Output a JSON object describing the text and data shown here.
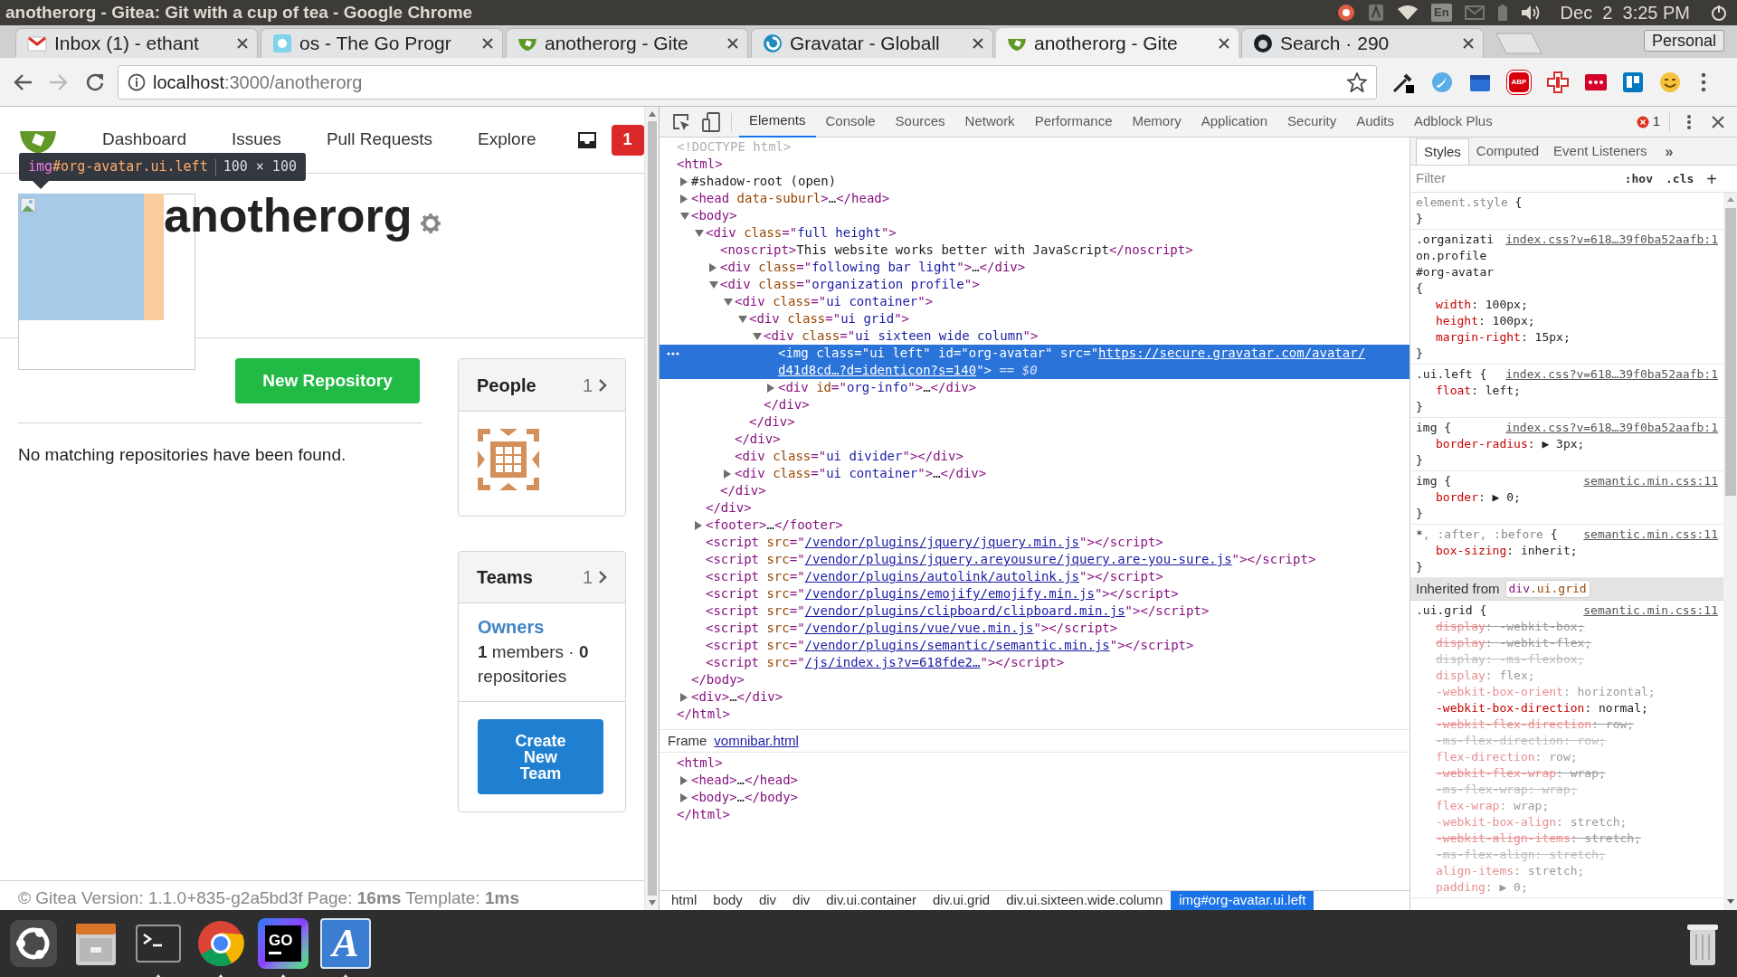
{
  "system_bar": {
    "window_title": "anotherorg - Gitea: Git with a cup of tea - Google Chrome",
    "keyboard_layout": "En",
    "clock": "Dec  2  3:25 PM"
  },
  "browser": {
    "tabs": [
      {
        "title": "Inbox (1) - ethant",
        "kind": "mail",
        "selected": false
      },
      {
        "title": "os - The Go Progr",
        "kind": "gopher",
        "selected": false
      },
      {
        "title": "anotherorg - Gite",
        "kind": "gitea",
        "selected": false
      },
      {
        "title": "Gravatar - Globall",
        "kind": "gravatar",
        "selected": false
      },
      {
        "title": "anotherorg - Gite",
        "kind": "gitea",
        "selected": true
      },
      {
        "title": "Search · 290",
        "kind": "github",
        "selected": false
      }
    ],
    "profile": "Personal",
    "address": {
      "host": "localhost",
      "path": ":3000/anotherorg"
    },
    "extensions": [
      {
        "kind": "eyedropper"
      },
      {
        "kind": "bird"
      },
      {
        "kind": "box"
      },
      {
        "kind": "adblock",
        "label": "ABP"
      },
      {
        "kind": "cross"
      },
      {
        "kind": "dots"
      },
      {
        "kind": "board"
      },
      {
        "kind": "emoji"
      }
    ]
  },
  "page": {
    "nav": [
      "Dashboard",
      "Issues",
      "Pull Requests",
      "Explore"
    ],
    "notifications": "1",
    "inspect_tooltip": {
      "tag": "img",
      "selector": "#org-avatar.ui.left",
      "size": "100 × 100"
    },
    "org_name": "anotherorg",
    "new_repository": "New Repository",
    "empty_message": "No matching repositories have been found.",
    "people": {
      "title": "People",
      "count": "1"
    },
    "teams": {
      "title": "Teams",
      "count": "1",
      "items": [
        {
          "name": "Owners",
          "summary": "**1** members · **0** repositories"
        }
      ],
      "create_button": "Create New Team"
    },
    "footer": "© Gitea Version: 1.1.0+835-g2a5bd3f Page: **16ms** Template: **1ms**"
  },
  "devtools": {
    "tabs": [
      {
        "label": "Elements",
        "selected": true
      },
      {
        "label": "Console",
        "selected": false
      },
      {
        "label": "Sources",
        "selected": false
      },
      {
        "label": "Network",
        "selected": false
      },
      {
        "label": "Performance",
        "selected": false
      },
      {
        "label": "Memory",
        "selected": false
      },
      {
        "label": "Application",
        "selected": false
      },
      {
        "label": "Security",
        "selected": false
      },
      {
        "label": "Audits",
        "selected": false
      },
      {
        "label": "Adblock Plus",
        "selected": false
      }
    ],
    "error_count": "1",
    "dom": [
      {
        "selected": false,
        "open": [
          {
            "kind": "muted",
            "text": "<!DOCTYPE html>"
          }
        ]
      },
      {
        "selected": false,
        "open": [
          {
            "kind": "tag",
            "text": "<html>"
          }
        ],
        "close": [
          {
            "kind": "tag",
            "text": "</html>"
          }
        ],
        "children": [
          {
            "selected": false,
            "expanded": false,
            "open": [
              {
                "kind": "text",
                "text": "#shadow-root (open)"
              }
            ]
          },
          {
            "selected": false,
            "expanded": false,
            "open": [
              {
                "kind": "tag",
                "text": "<head"
              },
              {
                "kind": "attr",
                "text": " data-suburl"
              },
              {
                "kind": "tag",
                "text": ">"
              },
              {
                "kind": "text",
                "text": "…"
              },
              {
                "kind": "tag",
                "text": "</head>"
              }
            ]
          },
          {
            "selected": false,
            "expanded": true,
            "open": [
              {
                "kind": "tag",
                "text": "<body>"
              }
            ],
            "close": [
              {
                "kind": "tag",
                "text": "</body>"
              }
            ],
            "children": [
              {
                "selected": false,
                "expanded": true,
                "open": [
                  {
                    "kind": "tag",
                    "text": "<div"
                  },
                  {
                    "kind": "attr",
                    "text": " class"
                  },
                  {
                    "kind": "tag",
                    "text": "=\""
                  },
                  {
                    "kind": "value",
                    "text": "full height"
                  },
                  {
                    "kind": "tag",
                    "text": "\">"
                  }
                ],
                "close": [
                  {
                    "kind": "tag",
                    "text": "</div>"
                  }
                ],
                "children": [
                  {
                    "selected": false,
                    "open": [
                      {
                        "kind": "tag",
                        "text": "<noscript>"
                      },
                      {
                        "kind": "text",
                        "text": "This website works better with JavaScript"
                      },
                      {
                        "kind": "tag",
                        "text": "</noscript>"
                      }
                    ]
                  },
                  {
                    "selected": false,
                    "expanded": false,
                    "open": [
                      {
                        "kind": "tag",
                        "text": "<div"
                      },
                      {
                        "kind": "attr",
                        "text": " class"
                      },
                      {
                        "kind": "tag",
                        "text": "=\""
                      },
                      {
                        "kind": "value",
                        "text": "following bar light"
                      },
                      {
                        "kind": "tag",
                        "text": "\">"
                      },
                      {
                        "kind": "text",
                        "text": "…"
                      },
                      {
                        "kind": "tag",
                        "text": "</div>"
                      }
                    ]
                  },
                  {
                    "selected": false,
                    "expanded": true,
                    "open": [
                      {
                        "kind": "tag",
                        "text": "<div"
                      },
                      {
                        "kind": "attr",
                        "text": " class"
                      },
                      {
                        "kind": "tag",
                        "text": "=\""
                      },
                      {
                        "kind": "value",
                        "text": "organization profile"
                      },
                      {
                        "kind": "tag",
                        "text": "\">"
                      }
                    ],
                    "close": [
                      {
                        "kind": "tag",
                        "text": "</div>"
                      }
                    ],
                    "children": [
                      {
                        "selected": false,
                        "expanded": true,
                        "open": [
                          {
                            "kind": "tag",
                            "text": "<div"
                          },
                          {
                            "kind": "attr",
                            "text": " class"
                          },
                          {
                            "kind": "tag",
                            "text": "=\""
                          },
                          {
                            "kind": "value",
                            "text": "ui container"
                          },
                          {
                            "kind": "tag",
                            "text": "\">"
                          }
                        ],
                        "close": [
                          {
                            "kind": "tag",
                            "text": "</div>"
                          }
                        ],
                        "children": [
                          {
                            "selected": false,
                            "expanded": true,
                            "open": [
                              {
                                "kind": "tag",
                                "text": "<div"
                              },
                              {
                                "kind": "attr",
                                "text": " class"
                              },
                              {
                                "kind": "tag",
                                "text": "=\""
                              },
                              {
                                "kind": "value",
                                "text": "ui grid"
                              },
                              {
                                "kind": "tag",
                                "text": "\">"
                              }
                            ],
                            "close": [
                              {
                                "kind": "tag",
                                "text": "</div>"
                              }
                            ],
                            "children": [
                              {
                                "selected": false,
                                "expanded": true,
                                "open": [
                                  {
                                    "kind": "tag",
                                    "text": "<div"
                                  },
                                  {
                                    "kind": "attr",
                                    "text": " class"
                                  },
                                  {
                                    "kind": "tag",
                                    "text": "=\""
                                  },
                                  {
                                    "kind": "value",
                                    "text": "ui sixteen wide column"
                                  },
                                  {
                                    "kind": "tag",
                                    "text": "\">"
                                  }
                                ],
                                "close": [
                                  {
                                    "kind": "tag",
                                    "text": "</div>"
                                  }
                                ],
                                "children": [
                                  {
                                    "selected": true,
                                    "open": [
                                      {
                                        "kind": "tag",
                                        "text": "<img"
                                      },
                                      {
                                        "kind": "attr",
                                        "text": " class"
                                      },
                                      {
                                        "kind": "tag",
                                        "text": "=\""
                                      },
                                      {
                                        "kind": "value",
                                        "text": "ui left"
                                      },
                                      {
                                        "kind": "tag",
                                        "text": "\""
                                      },
                                      {
                                        "kind": "attr",
                                        "text": " id"
                                      },
                                      {
                                        "kind": "tag",
                                        "text": "=\""
                                      },
                                      {
                                        "kind": "value",
                                        "text": "org-avatar"
                                      },
                                      {
                                        "kind": "tag",
                                        "text": "\""
                                      },
                                      {
                                        "kind": "attr",
                                        "text": " src"
                                      },
                                      {
                                        "kind": "tag",
                                        "text": "=\""
                                      },
                                      {
                                        "kind": "link",
                                        "text": "https://secure.gravatar.com/avatar/"
                                      },
                                      {
                                        "kind": "link",
                                        "text": "d41d8cd…?d=identicon?s=140"
                                      },
                                      {
                                        "kind": "tag",
                                        "text": "\">"
                                      },
                                      {
                                        "kind": "hint",
                                        "text": " == $0"
                                      }
                                    ]
                                  },
                                  {
                                    "selected": false,
                                    "expanded": false,
                                    "open": [
                                      {
                                        "kind": "tag",
                                        "text": "<div"
                                      },
                                      {
                                        "kind": "attr",
                                        "text": " id"
                                      },
                                      {
                                        "kind": "tag",
                                        "text": "=\""
                                      },
                                      {
                                        "kind": "value",
                                        "text": "org-info"
                                      },
                                      {
                                        "kind": "tag",
                                        "text": "\">"
                                      },
                                      {
                                        "kind": "text",
                                        "text": "…"
                                      },
                                      {
                                        "kind": "tag",
                                        "text": "</div>"
                                      }
                                    ]
                                  }
                                ]
                              }
                            ]
                          }
                        ]
                      },
                      {
                        "selected": false,
                        "open": [
                          {
                            "kind": "tag",
                            "text": "<div"
                          },
                          {
                            "kind": "attr",
                            "text": " class"
                          },
                          {
                            "kind": "tag",
                            "text": "=\""
                          },
                          {
                            "kind": "value",
                            "text": "ui divider"
                          },
                          {
                            "kind": "tag",
                            "text": "\"></div>"
                          }
                        ]
                      },
                      {
                        "selected": false,
                        "expanded": false,
                        "open": [
                          {
                            "kind": "tag",
                            "text": "<div"
                          },
                          {
                            "kind": "attr",
                            "text": " class"
                          },
                          {
                            "kind": "tag",
                            "text": "=\""
                          },
                          {
                            "kind": "value",
                            "text": "ui container"
                          },
                          {
                            "kind": "tag",
                            "text": "\">"
                          },
                          {
                            "kind": "text",
                            "text": "…"
                          },
                          {
                            "kind": "tag",
                            "text": "</div>"
                          }
                        ]
                      }
                    ]
                  }
                ]
              },
              {
                "selected": false,
                "expanded": false,
                "open": [
                  {
                    "kind": "tag",
                    "text": "<footer>"
                  },
                  {
                    "kind": "text",
                    "text": "…"
                  },
                  {
                    "kind": "tag",
                    "text": "</footer>"
                  }
                ]
              },
              {
                "selected": false,
                "open": [
                  {
                    "kind": "tag",
                    "text": "<script"
                  },
                  {
                    "kind": "attr",
                    "text": " src"
                  },
                  {
                    "kind": "tag",
                    "text": "=\""
                  },
                  {
                    "kind": "link",
                    "text": "/vendor/plugins/jquery/jquery.min.js"
                  },
                  {
                    "kind": "tag",
                    "text": "\"></script>"
                  }
                ]
              },
              {
                "selected": false,
                "open": [
                  {
                    "kind": "tag",
                    "text": "<script"
                  },
                  {
                    "kind": "attr",
                    "text": " src"
                  },
                  {
                    "kind": "tag",
                    "text": "=\""
                  },
                  {
                    "kind": "link",
                    "text": "/vendor/plugins/jquery.areyousure/jquery.are-you-sure.js"
                  },
                  {
                    "kind": "tag",
                    "text": "\"></script>"
                  }
                ]
              },
              {
                "selected": false,
                "open": [
                  {
                    "kind": "tag",
                    "text": "<script"
                  },
                  {
                    "kind": "attr",
                    "text": " src"
                  },
                  {
                    "kind": "tag",
                    "text": "=\""
                  },
                  {
                    "kind": "link",
                    "text": "/vendor/plugins/autolink/autolink.js"
                  },
                  {
                    "kind": "tag",
                    "text": "\"></script>"
                  }
                ]
              },
              {
                "selected": false,
                "open": [
                  {
                    "kind": "tag",
                    "text": "<script"
                  },
                  {
                    "kind": "attr",
                    "text": " src"
                  },
                  {
                    "kind": "tag",
                    "text": "=\""
                  },
                  {
                    "kind": "link",
                    "text": "/vendor/plugins/emojify/emojify.min.js"
                  },
                  {
                    "kind": "tag",
                    "text": "\"></script>"
                  }
                ]
              },
              {
                "selected": false,
                "open": [
                  {
                    "kind": "tag",
                    "text": "<script"
                  },
                  {
                    "kind": "attr",
                    "text": " src"
                  },
                  {
                    "kind": "tag",
                    "text": "=\""
                  },
                  {
                    "kind": "link",
                    "text": "/vendor/plugins/clipboard/clipboard.min.js"
                  },
                  {
                    "kind": "tag",
                    "text": "\"></script>"
                  }
                ]
              },
              {
                "selected": false,
                "open": [
                  {
                    "kind": "tag",
                    "text": "<script"
                  },
                  {
                    "kind": "attr",
                    "text": " src"
                  },
                  {
                    "kind": "tag",
                    "text": "=\""
                  },
                  {
                    "kind": "link",
                    "text": "/vendor/plugins/vue/vue.min.js"
                  },
                  {
                    "kind": "tag",
                    "text": "\"></script>"
                  }
                ]
              },
              {
                "selected": false,
                "open": [
                  {
                    "kind": "tag",
                    "text": "<script"
                  },
                  {
                    "kind": "attr",
                    "text": " src"
                  },
                  {
                    "kind": "tag",
                    "text": "=\""
                  },
                  {
                    "kind": "link",
                    "text": "/vendor/plugins/semantic/semantic.min.js"
                  },
                  {
                    "kind": "tag",
                    "text": "\"></script>"
                  }
                ]
              },
              {
                "selected": false,
                "open": [
                  {
                    "kind": "tag",
                    "text": "<script"
                  },
                  {
                    "kind": "attr",
                    "text": " src"
                  },
                  {
                    "kind": "tag",
                    "text": "=\""
                  },
                  {
                    "kind": "link",
                    "text": "/js/index.js?v=618fde2…"
                  },
                  {
                    "kind": "tag",
                    "text": "\"></script>"
                  }
                ]
              }
            ]
          },
          {
            "selected": false,
            "expanded": false,
            "open": [
              {
                "kind": "tag",
                "text": "<div>"
              },
              {
                "kind": "text",
                "text": "…"
              },
              {
                "kind": "tag",
                "text": "</div>"
              }
            ]
          }
        ]
      }
    ],
    "frame": {
      "label": "Frame",
      "link": "vomnibar.html",
      "dom": [
        {
          "selected": false,
          "open": [
            {
              "kind": "tag",
              "text": "<html>"
            }
          ],
          "close": [
            {
              "kind": "tag",
              "text": "</html>"
            }
          ],
          "children": [
            {
              "selected": false,
              "expanded": false,
              "open": [
                {
                  "kind": "tag",
                  "text": "<head>"
                },
                {
                  "kind": "text",
                  "text": "…"
                },
                {
                  "kind": "tag",
                  "text": "</head>"
                }
              ]
            },
            {
              "selected": false,
              "expanded": false,
              "open": [
                {
                  "kind": "tag",
                  "text": "<body>"
                },
                {
                  "kind": "text",
                  "text": "…"
                },
                {
                  "kind": "tag",
                  "text": "</body>"
                }
              ]
            }
          ]
        }
      ]
    },
    "breadcrumbs": [
      {
        "label": "html",
        "selected": false
      },
      {
        "label": "body",
        "selected": false
      },
      {
        "label": "div",
        "selected": false
      },
      {
        "label": "div",
        "selected": false
      },
      {
        "label": "div.ui.container",
        "selected": false
      },
      {
        "label": "div.ui.grid",
        "selected": false
      },
      {
        "label": "div.ui.sixteen.wide.column",
        "selected": false
      },
      {
        "label": "img#org-avatar.ui.left",
        "selected": true
      }
    ],
    "styles": {
      "tabs": [
        {
          "label": "Styles",
          "selected": true
        },
        {
          "label": "Computed",
          "selected": false
        },
        {
          "label": "Event Listeners",
          "selected": false
        }
      ],
      "more": "»",
      "filter_placeholder": "Filter",
      "hov": ":hov",
      "cls": ".cls",
      "add": "+",
      "rules": [
        {
          "selector": [
            {
              "text": "element.style",
              "matched": false
            }
          ],
          "open_brace": "{",
          "close_brace": "}"
        },
        {
          "selector": [
            {
              "text": ".organization.profile #org-avatar",
              "matched": true
            }
          ],
          "open_brace": "{",
          "close_brace": "}",
          "source": "index.css?v=618…39f0ba52aafb:1",
          "declarations": [
            {
              "text": "width: 100px;",
              "kind": "active"
            },
            {
              "text": "height: 100px;",
              "kind": "active"
            },
            {
              "text": "margin-right: 15px;",
              "kind": "active"
            }
          ]
        },
        {
          "selector": [
            {
              "text": ".ui.left",
              "matched": true
            }
          ],
          "open_brace": "{",
          "close_brace": "}",
          "source": "index.css?v=618…39f0ba52aafb:1",
          "declarations": [
            {
              "text": "float: left;",
              "kind": "active"
            }
          ]
        },
        {
          "selector": [
            {
              "text": "img",
              "matched": true
            }
          ],
          "open_brace": "{",
          "close_brace": "}",
          "source": "index.css?v=618…39f0ba52aafb:1",
          "declarations": [
            {
              "text": "border-radius: ▶ 3px;",
              "kind": "active"
            }
          ]
        },
        {
          "selector": [
            {
              "text": "img",
              "matched": true
            }
          ],
          "open_brace": "{",
          "close_brace": "}",
          "source": "semantic.min.css:11",
          "declarations": [
            {
              "text": "border: ▶ 0;",
              "kind": "active"
            }
          ]
        },
        {
          "selector": [
            {
              "text": "*",
              "matched": true
            },
            {
              "text": ", :after, :before",
              "matched": false
            }
          ],
          "open_brace": "{",
          "close_brace": "}",
          "source": "semantic.min.css:11",
          "declarations": [
            {
              "text": "box-sizing: inherit;",
              "kind": "active"
            }
          ]
        }
      ],
      "inherited": {
        "label": "Inherited from",
        "element_tag": "div",
        "element_classes": ".ui.grid",
        "rules": [
          {
            "selector": [
              {
                "text": ".ui.grid",
                "matched": true
              }
            ],
            "open_brace": "{",
            "source": "semantic.min.css:11",
            "declarations": [
              {
                "text": "display: -webkit-box;",
                "kind": "overridden"
              },
              {
                "text": "display: -webkit-flex;",
                "kind": "overridden"
              },
              {
                "text": "display: -ms-flexbox;",
                "kind": "unsupported"
              },
              {
                "text": "display: flex;",
                "kind": "faded"
              },
              {
                "text": "-webkit-box-orient: horizontal;",
                "kind": "faded"
              },
              {
                "text": "-webkit-box-direction: normal;",
                "kind": "active"
              },
              {
                "text": "-webkit-flex-direction: row;",
                "kind": "overridden"
              },
              {
                "text": "-ms-flex-direction: row;",
                "kind": "unsupported"
              },
              {
                "text": "flex-direction: row;",
                "kind": "faded"
              },
              {
                "text": "-webkit-flex-wrap: wrap;",
                "kind": "overridden"
              },
              {
                "text": "-ms-flex-wrap: wrap;",
                "kind": "unsupported"
              },
              {
                "text": "flex-wrap: wrap;",
                "kind": "faded"
              },
              {
                "text": "-webkit-box-align: stretch;",
                "kind": "faded"
              },
              {
                "text": "-webkit-align-items: stretch;",
                "kind": "overridden"
              },
              {
                "text": "-ms-flex-align: stretch;",
                "kind": "unsupported"
              },
              {
                "text": "align-items: stretch;",
                "kind": "faded"
              },
              {
                "text": "padding: ▶ 0;",
                "kind": "faded"
              }
            ]
          }
        ]
      }
    }
  },
  "dock": [
    {
      "kind": "ubuntu",
      "running": false
    },
    {
      "kind": "files",
      "running": false
    },
    {
      "kind": "terminal",
      "running": true
    },
    {
      "kind": "chrome",
      "running": true
    },
    {
      "kind": "goland",
      "label": "GO",
      "running": true
    },
    {
      "kind": "font",
      "label": "A",
      "running": true
    }
  ]
}
